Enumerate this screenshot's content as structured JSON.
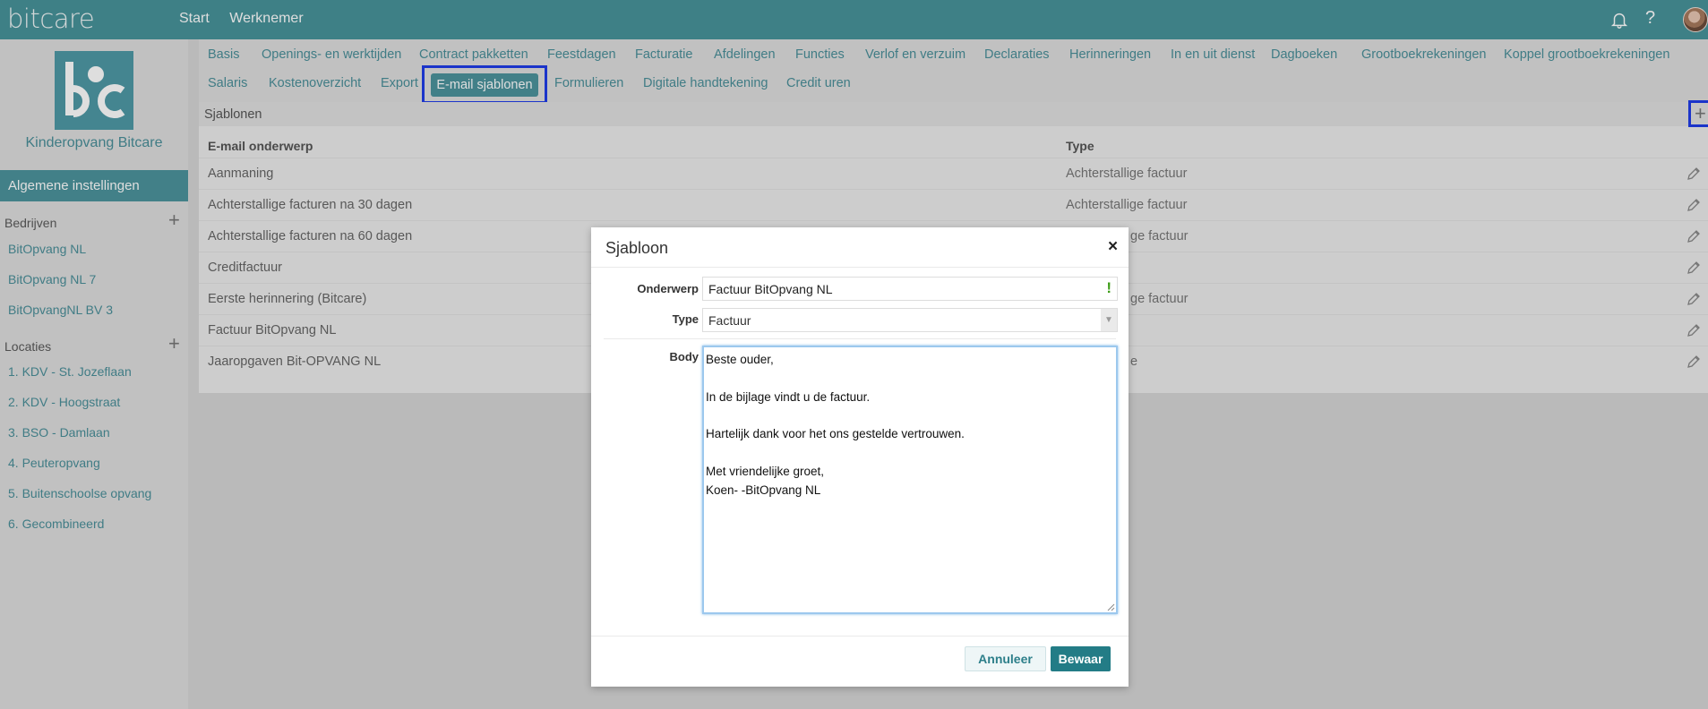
{
  "topbar": {
    "logo": "bitcare",
    "nav": [
      "Start",
      "Werknemer"
    ],
    "icons": [
      "bell-icon",
      "help-icon",
      "avatar"
    ]
  },
  "sidebar": {
    "org_name": "Kinderopvang Bitcare",
    "active_section": "Algemene instellingen",
    "companies_label": "Bedrijven",
    "companies": [
      "BitOpvang NL",
      "BitOpvang NL 7",
      "BitOpvangNL BV 3"
    ],
    "locations_label": "Locaties",
    "locations": [
      "1. KDV - St. Jozeflaan",
      "2. KDV - Hoogstraat",
      "3. BSO - Damlaan",
      "4. Peuteropvang",
      "5. Buitenschoolse opvang",
      "6. Gecombineerd"
    ]
  },
  "tabs": {
    "row1": [
      "Basis",
      "Openings- en werktijden",
      "Contract pakketten",
      "Feestdagen",
      "Facturatie",
      "Afdelingen",
      "Functies",
      "Verlof en verzuim",
      "Declaraties",
      "Herinneringen",
      "In en uit dienst",
      "Dagboeken",
      "Grootboekrekeningen",
      "Koppel grootboekrekeningen"
    ],
    "row2": [
      "Salaris",
      "Kostenoverzicht",
      "Export",
      "E-mail sjablonen",
      "Formulieren",
      "Digitale handtekening",
      "Credit uren"
    ],
    "active": "E-mail sjablonen"
  },
  "panel": {
    "title": "Sjablonen",
    "columns": [
      "E-mail onderwerp",
      "Type"
    ],
    "rows": [
      {
        "subject": "Aanmaning",
        "type": "Achterstallige factuur"
      },
      {
        "subject": "Achterstallige facturen na 30 dagen",
        "type": "Achterstallige factuur"
      },
      {
        "subject": "Achterstallige facturen na 60 dagen",
        "type": "ge factuur"
      },
      {
        "subject": "Creditfactuur",
        "type": ""
      },
      {
        "subject": "Eerste herinnering (Bitcare)",
        "type": "ge factuur"
      },
      {
        "subject": "Factuur BitOpvang NL",
        "type": ""
      },
      {
        "subject": "Jaaropgaven Bit-OPVANG NL",
        "type": "e"
      }
    ]
  },
  "modal": {
    "title": "Sjabloon",
    "close_symbol": "×",
    "subject_label": "Onderwerp",
    "subject_value": "Factuur BitOpvang NL",
    "subject_warning": "!",
    "type_label": "Type",
    "type_value": "Factuur",
    "body_label": "Body",
    "body_lines": [
      "Beste ouder,",
      "",
      "In de bijlage vindt u de factuur.",
      "",
      "Hartelijk dank voor het ons gestelde vertrouwen.",
      "",
      "Met vriendelijke groet,",
      "Koen- -BitOpvang NL"
    ],
    "cancel_label": "Annuleer",
    "save_label": "Bewaar"
  },
  "colors": {
    "brand": "#48939a",
    "link": "#4a8f99",
    "primary_button": "#237c86",
    "highlight": "#1f3ce8",
    "warning": "#3e9d18"
  }
}
